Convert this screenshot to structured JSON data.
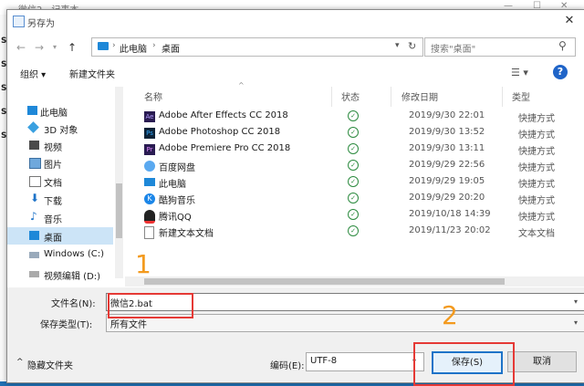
{
  "background": {
    "title": "微信2 - 记事本",
    "side_letters": [
      "S",
      "S",
      "S",
      "S",
      "S"
    ]
  },
  "dialog": {
    "title": "另存为",
    "close_glyph": "✕"
  },
  "address": {
    "crumbs": [
      "此电脑",
      "桌面"
    ],
    "search_placeholder": "搜索\"桌面\""
  },
  "toolbar": {
    "organize": "组织 ▾",
    "new_folder": "新建文件夹"
  },
  "nav_pane": [
    {
      "label": "此电脑",
      "icon": "computer-icon"
    },
    {
      "label": "3D 对象",
      "icon": "cube-icon"
    },
    {
      "label": "视频",
      "icon": "video-icon"
    },
    {
      "label": "图片",
      "icon": "pictures-icon"
    },
    {
      "label": "文档",
      "icon": "documents-icon"
    },
    {
      "label": "下载",
      "icon": "download-icon"
    },
    {
      "label": "音乐",
      "icon": "music-icon"
    },
    {
      "label": "桌面",
      "icon": "desktop-icon",
      "selected": true
    },
    {
      "label": "Windows (C:)",
      "icon": "drive-icon"
    },
    {
      "label": "视频编辑 (D:)",
      "icon": "drive-icon"
    }
  ],
  "columns": {
    "name": "名称",
    "status": "状态",
    "date": "修改日期",
    "type": "类型"
  },
  "files": [
    {
      "name": "Adobe After Effects CC 2018",
      "date": "2019/9/30 22:01",
      "type": "快捷方式",
      "icon": "after-effects-icon"
    },
    {
      "name": "Adobe Photoshop CC 2018",
      "date": "2019/9/30 13:52",
      "type": "快捷方式",
      "icon": "photoshop-icon"
    },
    {
      "name": "Adobe Premiere Pro CC 2018",
      "date": "2019/9/30 13:11",
      "type": "快捷方式",
      "icon": "premiere-icon"
    },
    {
      "name": "百度网盘",
      "date": "2019/9/29 22:56",
      "type": "快捷方式",
      "icon": "baidu-netdisk-icon"
    },
    {
      "name": "此电脑",
      "date": "2019/9/29 19:05",
      "type": "快捷方式",
      "icon": "computer-icon"
    },
    {
      "name": "酷狗音乐",
      "date": "2019/9/29 20:20",
      "type": "快捷方式",
      "icon": "kugou-icon"
    },
    {
      "name": "腾讯QQ",
      "date": "2019/10/18 14:39",
      "type": "快捷方式",
      "icon": "qq-icon"
    },
    {
      "name": "新建文本文档",
      "date": "2019/11/23 20:02",
      "type": "文本文档",
      "icon": "text-file-icon"
    }
  ],
  "form": {
    "filename_label": "文件名(N):",
    "filename_value": "微信2.bat",
    "filetype_label": "保存类型(T):",
    "filetype_value": "所有文件",
    "hide_folders": "隐藏文件夹",
    "encoding_label": "编码(E):",
    "encoding_value": "UTF-8",
    "save": "保存(S)",
    "cancel": "取消"
  },
  "annotations": [
    "1",
    "2"
  ],
  "colors": {
    "accent": "#1e73c8",
    "annotation_box": "#e53935",
    "annotation_number": "#f39a1e",
    "selected_nav": "#cce4f7"
  }
}
